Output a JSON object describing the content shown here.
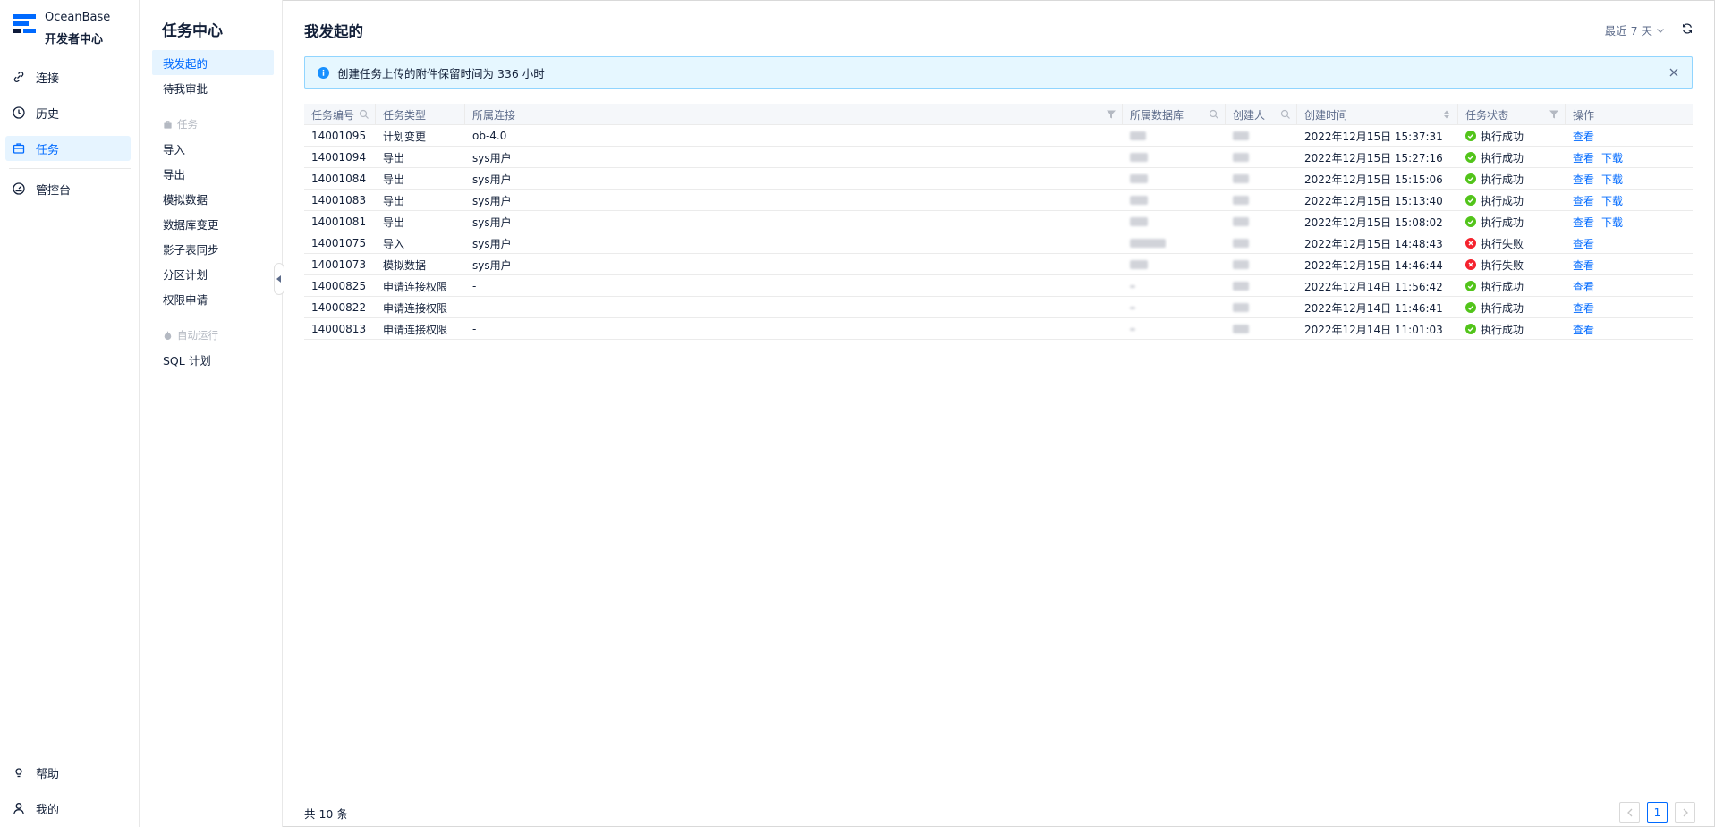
{
  "brand": {
    "name": "OceanBase",
    "sub": "开发者中心"
  },
  "leftnav": {
    "items": [
      {
        "label": "连接",
        "icon": "link-icon"
      },
      {
        "label": "历史",
        "icon": "clock-icon"
      },
      {
        "label": "任务",
        "icon": "briefcase-icon"
      },
      {
        "label": "管控台",
        "icon": "dashboard-icon"
      }
    ],
    "bottom": [
      {
        "label": "帮助",
        "icon": "bulb-icon"
      },
      {
        "label": "我的",
        "icon": "user-icon"
      }
    ]
  },
  "subnav": {
    "title": "任务中心",
    "top_items": [
      "我发起的",
      "待我审批"
    ],
    "group_task": "任务",
    "task_items": [
      "导入",
      "导出",
      "模拟数据",
      "数据库变更",
      "影子表同步",
      "分区计划",
      "权限申请"
    ],
    "group_auto": "自动运行",
    "auto_items": [
      "SQL 计划"
    ]
  },
  "main": {
    "title": "我发起的",
    "range": "最近 7 天",
    "alert": "创建任务上传的附件保留时间为 336 小时",
    "columns": [
      "任务编号",
      "任务类型",
      "所属连接",
      "所属数据库",
      "创建人",
      "创建时间",
      "任务状态",
      "操作"
    ],
    "rows": [
      {
        "id": "14001095",
        "type": "计划变更",
        "conn": "ob-4.0",
        "time": "2022年12月15日 15:37:31",
        "status": "执行成功",
        "ok": true,
        "ops": [
          "查看"
        ]
      },
      {
        "id": "14001094",
        "type": "导出",
        "conn": "sys用户",
        "time": "2022年12月15日 15:27:16",
        "status": "执行成功",
        "ok": true,
        "ops": [
          "查看",
          "下载"
        ]
      },
      {
        "id": "14001084",
        "type": "导出",
        "conn": "sys用户",
        "time": "2022年12月15日 15:15:06",
        "status": "执行成功",
        "ok": true,
        "ops": [
          "查看",
          "下载"
        ]
      },
      {
        "id": "14001083",
        "type": "导出",
        "conn": "sys用户",
        "time": "2022年12月15日 15:13:40",
        "status": "执行成功",
        "ok": true,
        "ops": [
          "查看",
          "下载"
        ]
      },
      {
        "id": "14001081",
        "type": "导出",
        "conn": "sys用户",
        "time": "2022年12月15日 15:08:02",
        "status": "执行成功",
        "ok": true,
        "ops": [
          "查看",
          "下载"
        ]
      },
      {
        "id": "14001075",
        "type": "导入",
        "conn": "sys用户",
        "time": "2022年12月15日 14:48:43",
        "status": "执行失败",
        "ok": false,
        "ops": [
          "查看"
        ]
      },
      {
        "id": "14001073",
        "type": "模拟数据",
        "conn": "sys用户",
        "time": "2022年12月15日 14:46:44",
        "status": "执行失败",
        "ok": false,
        "ops": [
          "查看"
        ]
      },
      {
        "id": "14000825",
        "type": "申请连接权限",
        "conn": "-",
        "time": "2022年12月14日 11:56:42",
        "status": "执行成功",
        "ok": true,
        "ops": [
          "查看"
        ]
      },
      {
        "id": "14000822",
        "type": "申请连接权限",
        "conn": "-",
        "time": "2022年12月14日 11:46:41",
        "status": "执行成功",
        "ok": true,
        "ops": [
          "查看"
        ]
      },
      {
        "id": "14000813",
        "type": "申请连接权限",
        "conn": "-",
        "time": "2022年12月14日 11:01:03",
        "status": "执行成功",
        "ok": true,
        "ops": [
          "查看"
        ]
      }
    ],
    "total": "共 10 条",
    "page": "1"
  },
  "colors": {
    "accent": "#006aff",
    "success": "#52c41a",
    "error": "#f5222d",
    "alert_bg": "#e6f7ff"
  }
}
